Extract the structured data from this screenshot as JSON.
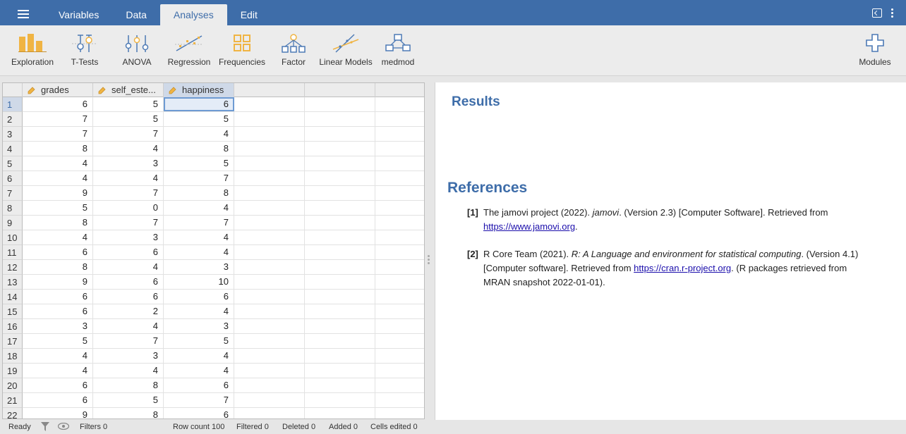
{
  "nav": {
    "tabs": [
      {
        "label": "Variables"
      },
      {
        "label": "Data"
      },
      {
        "label": "Analyses"
      },
      {
        "label": "Edit"
      }
    ],
    "active_tab": "Analyses"
  },
  "ribbon": {
    "exploration": "Exploration",
    "ttests": "T-Tests",
    "anova": "ANOVA",
    "regression": "Regression",
    "frequencies": "Frequencies",
    "factor": "Factor",
    "linear_models": "Linear Models",
    "medmod": "medmod",
    "modules": "Modules"
  },
  "sheet": {
    "columns": [
      "grades",
      "self_este...",
      "happiness"
    ],
    "rows": [
      {
        "n": "1",
        "v": [
          "6",
          "5",
          "6"
        ]
      },
      {
        "n": "2",
        "v": [
          "7",
          "5",
          "5"
        ]
      },
      {
        "n": "3",
        "v": [
          "7",
          "7",
          "4"
        ]
      },
      {
        "n": "4",
        "v": [
          "8",
          "4",
          "8"
        ]
      },
      {
        "n": "5",
        "v": [
          "4",
          "3",
          "5"
        ]
      },
      {
        "n": "6",
        "v": [
          "4",
          "4",
          "7"
        ]
      },
      {
        "n": "7",
        "v": [
          "9",
          "7",
          "8"
        ]
      },
      {
        "n": "8",
        "v": [
          "5",
          "0",
          "4"
        ]
      },
      {
        "n": "9",
        "v": [
          "8",
          "7",
          "7"
        ]
      },
      {
        "n": "10",
        "v": [
          "4",
          "3",
          "4"
        ]
      },
      {
        "n": "11",
        "v": [
          "6",
          "6",
          "4"
        ]
      },
      {
        "n": "12",
        "v": [
          "8",
          "4",
          "3"
        ]
      },
      {
        "n": "13",
        "v": [
          "9",
          "6",
          "10"
        ]
      },
      {
        "n": "14",
        "v": [
          "6",
          "6",
          "6"
        ]
      },
      {
        "n": "15",
        "v": [
          "6",
          "2",
          "4"
        ]
      },
      {
        "n": "16",
        "v": [
          "3",
          "4",
          "3"
        ]
      },
      {
        "n": "17",
        "v": [
          "5",
          "7",
          "5"
        ]
      },
      {
        "n": "18",
        "v": [
          "4",
          "3",
          "4"
        ]
      },
      {
        "n": "19",
        "v": [
          "4",
          "4",
          "4"
        ]
      },
      {
        "n": "20",
        "v": [
          "6",
          "8",
          "6"
        ]
      },
      {
        "n": "21",
        "v": [
          "6",
          "5",
          "7"
        ]
      },
      {
        "n": "22",
        "v": [
          "9",
          "8",
          "6"
        ]
      }
    ]
  },
  "status": {
    "ready": "Ready",
    "filters": "Filters 0",
    "row_count": "Row count 100",
    "filtered": "Filtered 0",
    "deleted": "Deleted 0",
    "added": "Added 0",
    "cells_edited": "Cells edited 0"
  },
  "results": {
    "title": "Results",
    "references_title": "References",
    "ref1": {
      "num": "[1]",
      "pre": "The jamovi project (2022). ",
      "italic": "jamovi",
      "post": ". (Version 2.3) [Computer Software]. Retrieved from ",
      "link": "https://www.jamovi.org",
      "end": "."
    },
    "ref2": {
      "num": "[2]",
      "pre": "R Core Team (2021). ",
      "italic": "R: A Language and environment for statistical computing",
      "post": ". (Version 4.1) [Computer software]. Retrieved from ",
      "link": "https://cran.r-project.org",
      "end": ". (R packages retrieved from MRAN snapshot 2022-01-01)."
    }
  },
  "colors": {
    "brand": "#3e6da9",
    "ribbon_orange": "#f0b443",
    "link": "#1a0dab"
  }
}
